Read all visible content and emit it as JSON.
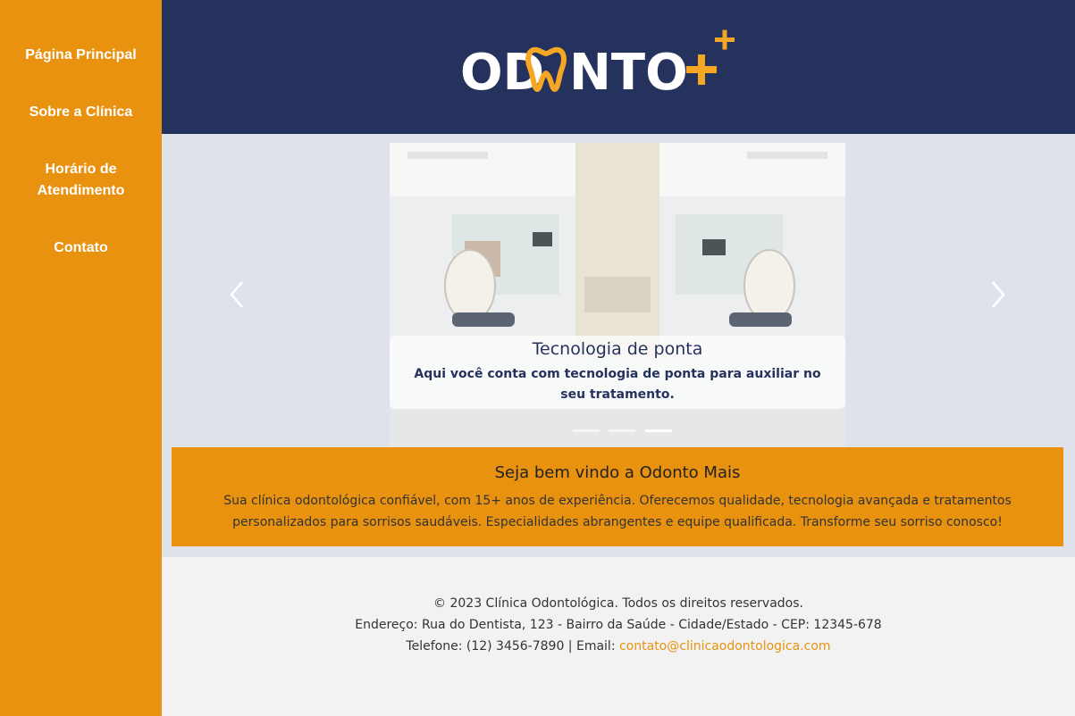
{
  "sidebar": {
    "items": [
      {
        "label": "Página Principal"
      },
      {
        "label": "Sobre a Clínica"
      },
      {
        "label": "Horário de Atendimento"
      },
      {
        "label": "Contato"
      }
    ]
  },
  "header": {
    "logo_text": "ODONTO+",
    "logo_icon": "tooth-icon",
    "colors": {
      "background": "#26325e",
      "accent": "#f5a623"
    }
  },
  "carousel": {
    "slide": {
      "title": "Tecnologia de ponta",
      "text": "Aqui você conta com tecnologia de ponta para auxiliar no seu tratamento."
    },
    "indicators": 3,
    "active_index": 2,
    "prev_icon": "chevron-left-icon",
    "next_icon": "chevron-right-icon"
  },
  "welcome": {
    "title": "Seja bem vindo a Odonto Mais",
    "text": "Sua clínica odontológica confiável, com 15+ anos de experiência. Oferecemos qualidade, tecnologia avançada e tratamentos personalizados para sorrisos saudáveis. Especialidades abrangentes e equipe qualificada. Transforme seu sorriso conosco!"
  },
  "footer": {
    "copyright": "© 2023 Clínica Odontológica. Todos os direitos reservados.",
    "address": "Endereço: Rua do Dentista, 123 - Bairro da Saúde - Cidade/Estado - CEP: 12345-678",
    "phone_prefix": "Telefone: (12) 3456-7890 | Email: ",
    "email": "contato@clinicaodontologica.com"
  },
  "colors": {
    "sidebar": "#e89210",
    "header": "#26325e",
    "hero_bg": "#dfe2ea",
    "footer_bg": "#f2f2f2",
    "link": "#e89210"
  }
}
